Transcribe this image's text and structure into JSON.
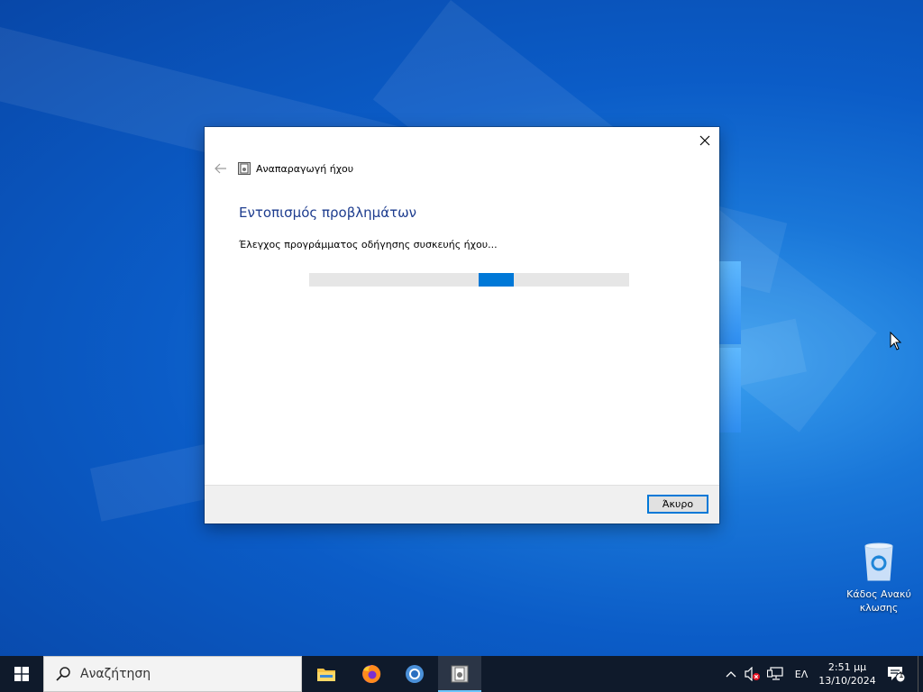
{
  "dialog": {
    "app_title": "Αναπαραγωγή ήχου",
    "heading": "Εντοπισμός προβλημάτων",
    "status": "Έλεγχος προγράμματος οδήγησης συσκευής ήχου...",
    "progress_indeterminate": true,
    "cancel_label": "Άκυρο",
    "close_icon": "close-icon",
    "back_icon": "back-arrow-icon",
    "accent_color": "#0078d7",
    "heading_color": "#1e3d8f"
  },
  "desktop": {
    "recycle_bin_label": "Κάδος Ανακύκλωσης",
    "recycle_bin_label_line1": "Κάδος Ανακύ",
    "recycle_bin_label_line2": "κλωσης"
  },
  "taskbar": {
    "search_placeholder": "Αναζήτηση",
    "apps": [
      {
        "name": "file-explorer",
        "icon": "folder-icon"
      },
      {
        "name": "firefox",
        "icon": "firefox-icon"
      },
      {
        "name": "chromium",
        "icon": "chromium-icon"
      },
      {
        "name": "audio-troubleshooter",
        "icon": "troubleshooter-icon",
        "active": true
      }
    ],
    "language": "ΕΛ",
    "time": "2:51 μμ",
    "date": "13/10/2024",
    "notification_count": "1"
  }
}
